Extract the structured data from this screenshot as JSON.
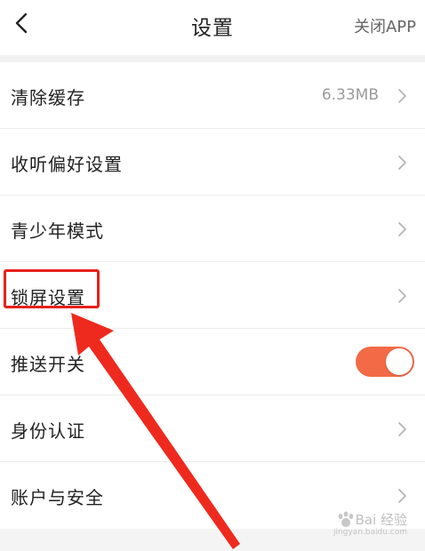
{
  "header": {
    "title": "设置",
    "close_label": "关闭APP"
  },
  "settings": {
    "clear_cache": {
      "label": "清除缓存",
      "value": "6.33MB"
    },
    "listening_pref": {
      "label": "收听偏好设置"
    },
    "youth_mode": {
      "label": "青少年模式"
    },
    "lock_screen": {
      "label": "锁屏设置"
    },
    "push_switch": {
      "label": "推送开关",
      "enabled": true
    },
    "identity": {
      "label": "身份认证"
    },
    "account_security": {
      "label": "账户与安全"
    }
  },
  "colors": {
    "toggle_on": "#f26a46",
    "annotation_red": "#e8201a"
  },
  "watermark": {
    "text": "Bai 经验",
    "sub": "jingyan.baidu.com"
  }
}
